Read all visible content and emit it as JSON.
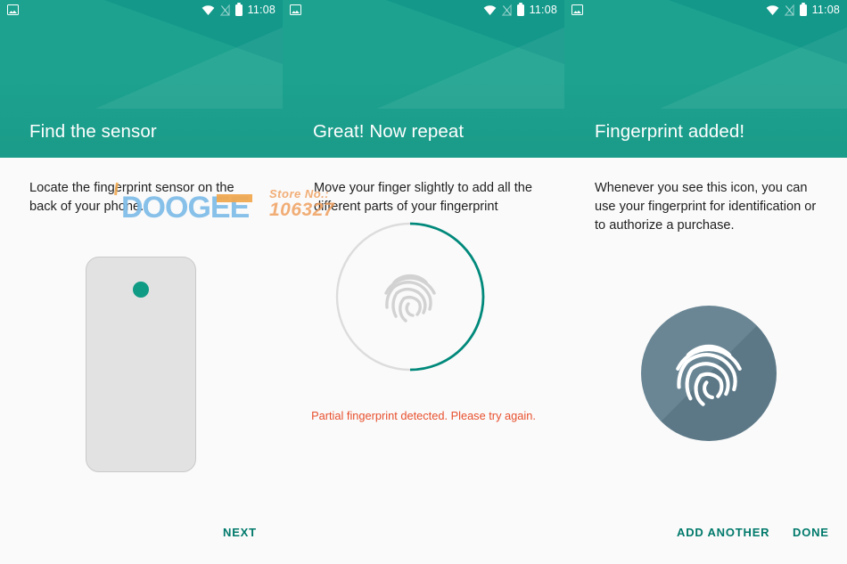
{
  "status_bar": {
    "time": "11:08",
    "icons": {
      "left": "photo-icon",
      "wifi": "wifi-icon",
      "signal": "signal-off-icon",
      "battery": "battery-full-icon"
    }
  },
  "colors": {
    "header_teal": "#1ca28f",
    "header_facet": "#13988a",
    "accent_action": "#00796b",
    "sensor_dot": "#0f9b84",
    "progress_ring": "#00897b",
    "ring_track": "#dcdcdc",
    "error_text": "#e8502e",
    "success_circle": "#62808f",
    "phone_body": "#e2e2e2",
    "page_bg": "#fafafa"
  },
  "panels": [
    {
      "id": "find-the-sensor",
      "title": "Find the sensor",
      "body": "Locate the fingerprint sensor on the back of your phone.",
      "illustration": "phone-back-with-sensor"
    },
    {
      "id": "great-now-repeat",
      "title": "Great! Now repeat",
      "body": "Move your finger slightly to add all the different parts of your fingerprint",
      "illustration": "fingerprint-progress-ring",
      "progress_percent": 50,
      "error_message": "Partial fingerprint detected. Please try again."
    },
    {
      "id": "fingerprint-added",
      "title": "Fingerprint added!",
      "body": "Whenever you see this icon, you can use your fingerprint for identification or to authorize a purchase.",
      "illustration": "fingerprint-badge"
    }
  ],
  "buttons": {
    "next": "NEXT",
    "add_another": "ADD ANOTHER",
    "done": "DONE"
  },
  "watermark": {
    "brand": "DOOGEE",
    "store_label": "Store No.:",
    "store_number": "106327"
  }
}
